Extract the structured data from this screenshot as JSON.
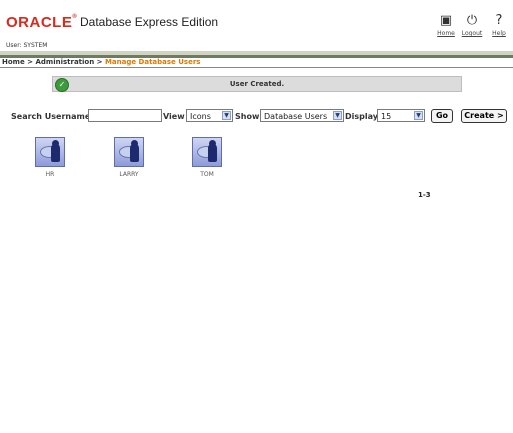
{
  "header": {
    "logo_text": "ORACLE",
    "product_name": "Database Express Edition",
    "user_line": "User: SYSTEM",
    "links": [
      {
        "label": "Home",
        "icon": "home-icon"
      },
      {
        "label": "Logout",
        "icon": "logout-icon"
      },
      {
        "label": "Help",
        "icon": "help-icon"
      }
    ]
  },
  "breadcrumb": {
    "home": "Home",
    "sep1": " > ",
    "admin": "Administration",
    "sep2": " > ",
    "current": "Manage Database Users"
  },
  "message": {
    "text": "User Created.",
    "icon": "check-icon"
  },
  "toolbar": {
    "search_label": "Search Username",
    "search_value": "",
    "view_label": "View",
    "view_value": "Icons",
    "show_label": "Show",
    "show_value": "Database Users",
    "display_label": "Display",
    "display_value": "15",
    "go_label": "Go",
    "create_label": "Create >"
  },
  "users": [
    "HR",
    "LARRY",
    "TOM"
  ],
  "pager": "1-3",
  "colors": {
    "brand": "#d72b1f",
    "breadcrumb_current": "#e07800",
    "bar_dark": "#6f7a63",
    "bar_light": "#cfd5c2"
  }
}
